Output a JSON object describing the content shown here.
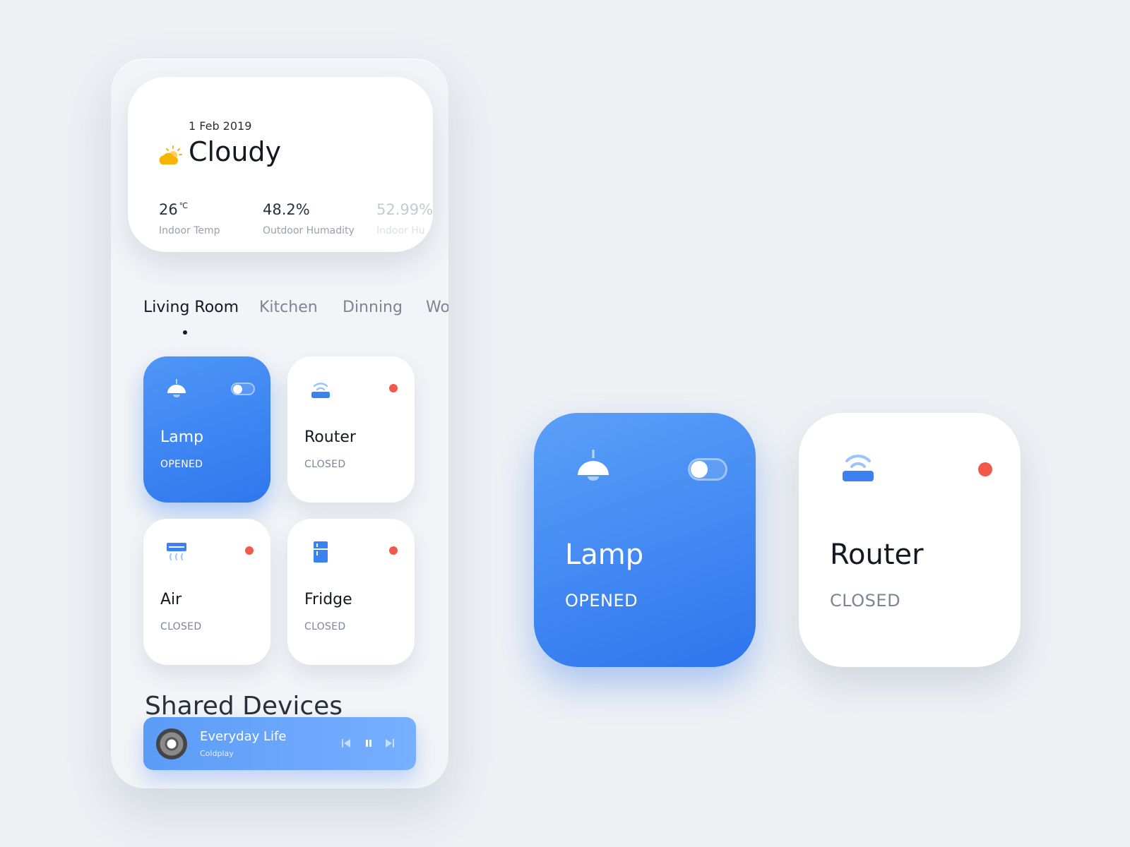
{
  "weather": {
    "date": "1 Feb 2019",
    "condition": "Cloudy",
    "icon": "cloud-sun-icon",
    "stats": [
      {
        "value": "26",
        "unit": "℃",
        "label": "Indoor Temp"
      },
      {
        "value": "48.2%",
        "unit": "",
        "label": "Outdoor Humadity"
      },
      {
        "value": "52.99%",
        "unit": "",
        "label": "Indoor Hu"
      }
    ]
  },
  "tabs": [
    {
      "label": "Living Room",
      "active": true
    },
    {
      "label": "Kitchen",
      "active": false
    },
    {
      "label": "Dinning",
      "active": false
    },
    {
      "label": "Wo",
      "active": false
    }
  ],
  "devices": [
    {
      "name": "Lamp",
      "state": "OPENED",
      "icon": "lamp-icon",
      "on": true
    },
    {
      "name": "Router",
      "state": "CLOSED",
      "icon": "router-icon",
      "on": false
    },
    {
      "name": "Air",
      "state": "CLOSED",
      "icon": "air-conditioner-icon",
      "on": false
    },
    {
      "name": "Fridge",
      "state": "CLOSED",
      "icon": "fridge-icon",
      "on": false
    }
  ],
  "shared": {
    "title": "Shared Devices"
  },
  "player": {
    "song": "Everyday Life",
    "artist": "Coldplay"
  },
  "preview": [
    {
      "name": "Lamp",
      "state": "OPENED"
    },
    {
      "name": "Router",
      "state": "CLOSED"
    }
  ],
  "colors": {
    "accent": "#2f77ee",
    "status_off": "#f2594b",
    "sun": "#f7b500"
  }
}
